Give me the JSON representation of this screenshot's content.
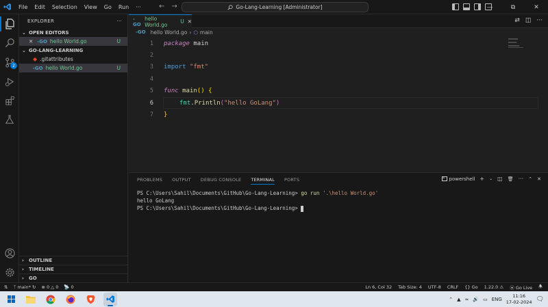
{
  "titlebar": {
    "menus": [
      "File",
      "Edit",
      "Selection",
      "View",
      "Go",
      "Run",
      "···"
    ],
    "search_text": "Go-Lang-Learning [Administrator]",
    "nav_back": "←",
    "nav_forward": "→"
  },
  "activity": {
    "source_control_badge": "2"
  },
  "sidebar": {
    "header": "EXPLORER",
    "more": "···",
    "open_editors_label": "OPEN EDITORS",
    "open_editor_file": "hello World.go",
    "open_editor_status": "U",
    "project_label": "GO-LANG-LEARNING",
    "files": [
      {
        "name": ".gitattributes",
        "status": ""
      },
      {
        "name": "hello World.go",
        "status": "U"
      }
    ],
    "outline_label": "OUTLINE",
    "timeline_label": "TIMELINE",
    "go_label": "GO"
  },
  "tab": {
    "name": "hello World.go",
    "status": "U",
    "close": "✕"
  },
  "breadcrumb": {
    "file": "hello World.go",
    "sep": "›",
    "symbol": "main"
  },
  "editor": {
    "line_numbers": [
      "1",
      "2",
      "3",
      "4",
      "5",
      "6",
      "7"
    ],
    "l1_kw": "package",
    "l1_rest": " main",
    "l3_kw": "import",
    "l3_str": "\"fmt\"",
    "l5_kw": "func",
    "l5_fn": "main",
    "l5_paren": "()",
    "l5_brace": "{",
    "l6_pkg": "fmt",
    "l6_dot": ".",
    "l6_fn": "Println",
    "l6_open": "(",
    "l6_str": "\"hello GoLang\"",
    "l6_close": ")",
    "l7_brace": "}"
  },
  "panel": {
    "tabs": [
      "PROBLEMS",
      "OUTPUT",
      "DEBUG CONSOLE",
      "TERMINAL",
      "PORTS"
    ],
    "active_tab": "TERMINAL",
    "shell": "powershell",
    "prompt": "PS C:\\Users\\Sahil\\Documents\\GitHub\\Go-Lang-Learning>",
    "cmd_go": "go run",
    "cmd_arg": "'.\\hello World.go'",
    "output": "hello GoLang",
    "prompt2": "PS C:\\Users\\Sahil\\Documents\\GitHub\\Go-Lang-Learning>"
  },
  "status": {
    "branch": "main*",
    "errors": "0",
    "warnings": "0",
    "ports": "0",
    "position": "Ln 6, Col 32",
    "tab_size": "Tab Size: 4",
    "encoding": "UTF-8",
    "eol": "CRLF",
    "language": "Go",
    "go_version": "1.22.0",
    "go_live": "Go Live"
  },
  "taskbar": {
    "lang": "ENG",
    "time": "11:16",
    "date": "17-02-2024"
  },
  "colors": {
    "accent": "#0078d4",
    "untracked": "#73c991"
  }
}
